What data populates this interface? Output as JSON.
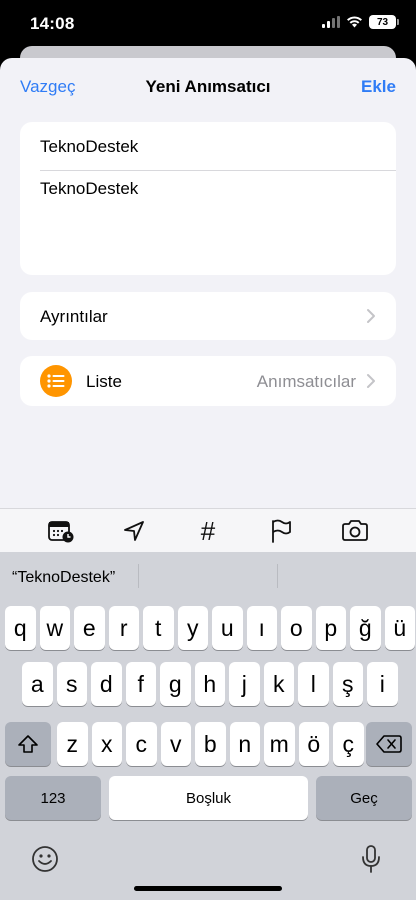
{
  "status": {
    "time": "14:08",
    "battery": "73"
  },
  "nav": {
    "cancel": "Vazgeç",
    "title": "Yeni Anımsatıcı",
    "add": "Ekle"
  },
  "form": {
    "title_value": "TeknoDestek",
    "notes_value": "TeknoDestek"
  },
  "details": {
    "label": "Ayrıntılar"
  },
  "list": {
    "label": "Liste",
    "value": "Anımsatıcılar"
  },
  "toolbar": {
    "icons": [
      "calendar-clock-icon",
      "location-arrow-icon",
      "hashtag-icon",
      "flag-icon",
      "camera-icon"
    ],
    "hash": "#"
  },
  "keyboard": {
    "suggestion": "“TeknoDestek”",
    "row1": [
      "q",
      "w",
      "e",
      "r",
      "t",
      "y",
      "u",
      "ı",
      "o",
      "p",
      "ğ",
      "ü"
    ],
    "row2": [
      "a",
      "s",
      "d",
      "f",
      "g",
      "h",
      "j",
      "k",
      "l",
      "ş",
      "i"
    ],
    "row3": [
      "z",
      "x",
      "c",
      "v",
      "b",
      "n",
      "m",
      "ö",
      "ç"
    ],
    "numbers": "123",
    "space": "Boşluk",
    "go": "Geç"
  },
  "colors": {
    "accent": "#2f7cf6",
    "list_icon": "#ff9500"
  }
}
